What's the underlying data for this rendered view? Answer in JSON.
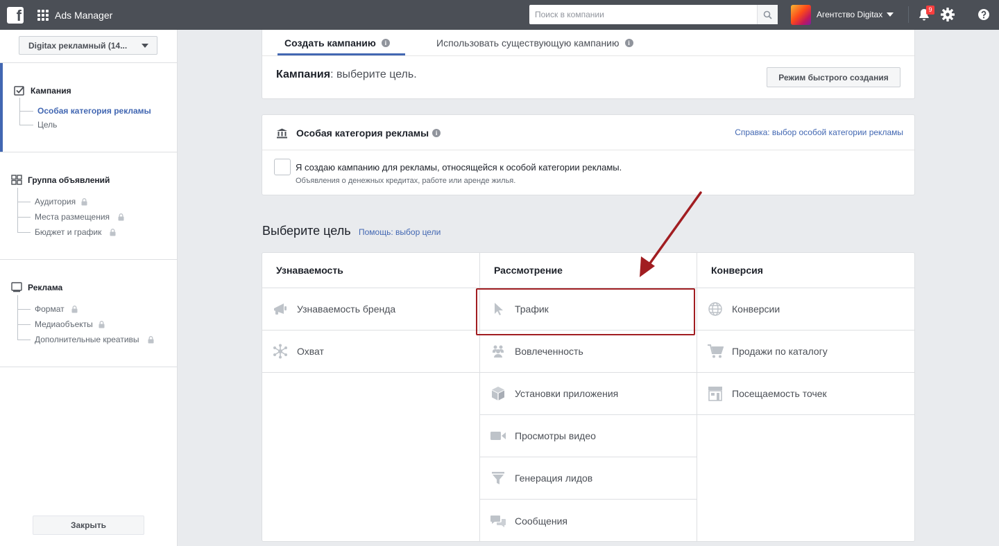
{
  "topbar": {
    "app_title": "Ads Manager",
    "search_placeholder": "Поиск в компании",
    "account_name": "Агентство Digitax",
    "notifications_count": "9",
    "logo_letter": "f"
  },
  "sidebar": {
    "account_select": "Digitax рекламный (14...",
    "campaign": {
      "title": "Кампания",
      "items": [
        {
          "label": "Особая категория рекламы",
          "active": true
        },
        {
          "label": "Цель",
          "active": false
        }
      ]
    },
    "adset": {
      "title": "Группа объявлений",
      "items": [
        {
          "label": "Аудитория",
          "locked": true
        },
        {
          "label": "Места размещения",
          "locked": true
        },
        {
          "label": "Бюджет и график",
          "locked": true
        }
      ]
    },
    "ad": {
      "title": "Реклама",
      "items": [
        {
          "label": "Формат",
          "locked": true
        },
        {
          "label": "Медиаобъекты",
          "locked": true
        },
        {
          "label": "Дополнительные креативы",
          "locked": true
        }
      ]
    },
    "close_label": "Закрыть"
  },
  "tabs": {
    "create": "Создать кампанию",
    "existing": "Использовать существующую кампанию"
  },
  "campaign_line": {
    "label": "Кампания",
    "hint": ": выберите цель."
  },
  "quick_create_label": "Режим быстрого создания",
  "special_category": {
    "title": "Особая категория рекламы",
    "help_link": "Справка: выбор особой категории рекламы",
    "checkbox_label": "Я создаю кампанию для рекламы, относящейся к особой категории рекламы.",
    "checkbox_sub": "Объявления о денежных кредитах, работе или аренде жилья."
  },
  "goal": {
    "title": "Выберите цель",
    "help_link": "Помощь: выбор цели"
  },
  "objectives": {
    "awareness": {
      "title": "Узнаваемость",
      "items": [
        {
          "label": "Узнаваемость бренда",
          "icon": "megaphone-icon"
        },
        {
          "label": "Охват",
          "icon": "reach-icon"
        }
      ]
    },
    "consideration": {
      "title": "Рассмотрение",
      "items": [
        {
          "label": "Трафик",
          "icon": "cursor-icon"
        },
        {
          "label": "Вовлеченность",
          "icon": "people-icon"
        },
        {
          "label": "Установки приложения",
          "icon": "box-icon"
        },
        {
          "label": "Просмотры видео",
          "icon": "video-camera-icon"
        },
        {
          "label": "Генерация лидов",
          "icon": "funnel-icon"
        },
        {
          "label": "Сообщения",
          "icon": "chat-bubbles-icon"
        }
      ]
    },
    "conversion": {
      "title": "Конверсия",
      "items": [
        {
          "label": "Конверсии",
          "icon": "globe-icon"
        },
        {
          "label": "Продажи по каталогу",
          "icon": "cart-icon"
        },
        {
          "label": "Посещаемость точек",
          "icon": "store-icon"
        }
      ]
    }
  },
  "colors": {
    "topbar": "#4b4f56",
    "accent": "#4267b2",
    "highlight": "#a11d21"
  }
}
